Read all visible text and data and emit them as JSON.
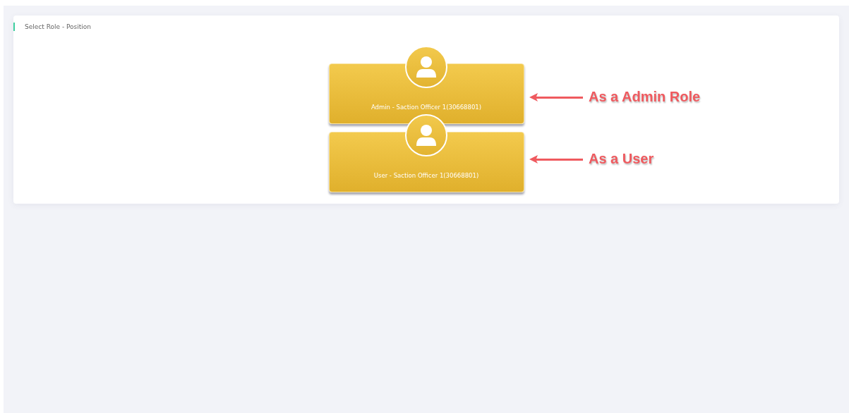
{
  "panel": {
    "title": "Select Role - Position"
  },
  "roles": [
    {
      "label": "Admin - Saction Officer 1(30668801)",
      "annotation": "As a Admin Role"
    },
    {
      "label": "User - Saction Officer 1(30668801)",
      "annotation": "As a User"
    }
  ]
}
